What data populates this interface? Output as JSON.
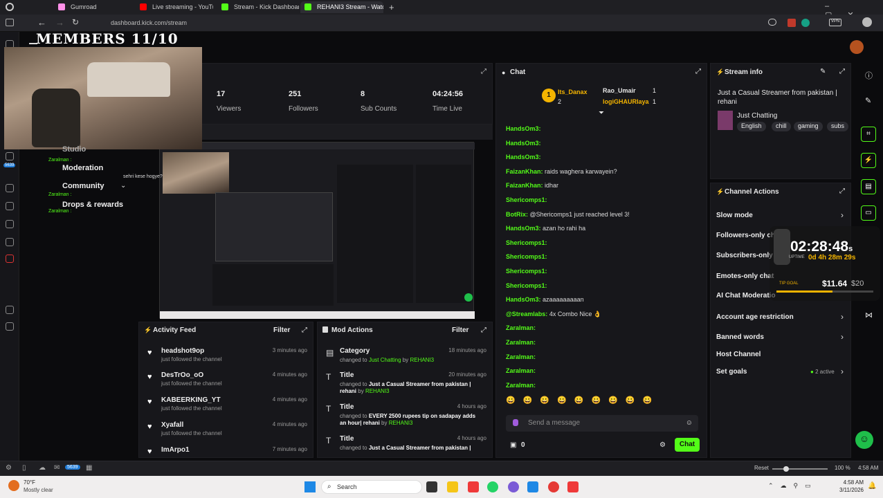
{
  "browser": {
    "tabs": [
      {
        "label": "Gumroad",
        "color": "#ff90e8",
        "active": false
      },
      {
        "label": "Live streaming - YouTube S",
        "color": "#ff0000",
        "active": false
      },
      {
        "label": "Stream - Kick Dashboard",
        "color": "#53fc18",
        "active": false
      },
      {
        "label": "REHANI3 Stream - Watch Li",
        "color": "#53fc18",
        "active": true
      }
    ],
    "new_tab": "+",
    "url": "dashboard.kick.com/stream"
  },
  "overlay": {
    "members": "MEMBERS 11/10"
  },
  "stats": {
    "viewers_value": "17",
    "viewers_label": "Viewers",
    "followers_value": "251",
    "followers_label": "Followers",
    "subs_value": "8",
    "subs_label": "Sub Counts",
    "time_value": "04:24:56",
    "time_label": "Time Live"
  },
  "nav": {
    "studio": "Studio",
    "moderation": "Moderation",
    "community": "Community",
    "drops": "Drops & rewards",
    "chat_snips": [
      "Zaralman :",
      "Zaralman :",
      "Zaralman :"
    ],
    "red_snip": "sehri kese hogye?"
  },
  "activity": {
    "title": "Activity Feed",
    "filter": "Filter",
    "items": [
      {
        "name": "headshot9op",
        "sub": "just followed the channel",
        "time": "3 minutes ago"
      },
      {
        "name": "DesTrOo_oO",
        "sub": "just followed the channel",
        "time": "4 minutes ago"
      },
      {
        "name": "KABEERKING_YT",
        "sub": "just followed the channel",
        "time": "4 minutes ago"
      },
      {
        "name": "Xyafall",
        "sub": "just followed the channel",
        "time": "4 minutes ago"
      },
      {
        "name": "ImArpo1",
        "sub": "",
        "time": "7 minutes ago"
      }
    ]
  },
  "mod": {
    "title": "Mod Actions",
    "filter": "Filter",
    "items": [
      {
        "title": "Category",
        "pre": "changed to",
        "val": "Just Chatting",
        "by": "by",
        "user": "REHANI3",
        "time": "18 minutes ago"
      },
      {
        "title": "Title",
        "pre": "changed to",
        "val": "Just a Casual Streamer from pakistan | rehani",
        "by": "by",
        "user": "REHANI3",
        "time": "20 minutes ago"
      },
      {
        "title": "Title",
        "pre": "changed to",
        "val": "EVERY 2500 rupees tip on sadapay adds an hour| rehani",
        "by": "by",
        "user": "REHANI3",
        "time": "4 hours ago"
      },
      {
        "title": "Title",
        "pre": "changed to",
        "val": "Just a Casual Streamer from pakistan |",
        "by": "",
        "user": "",
        "time": "4 hours ago"
      }
    ]
  },
  "chat": {
    "title": "Chat",
    "top_gifter1": "Its_Danax",
    "top_gifter1_count": "2",
    "top_gifter2": "Rao_Umair",
    "top_gifter2_count": "1",
    "top_gifter3": "logiGHAURIaya",
    "top_gifter3_count": "1",
    "lines": [
      {
        "user": "HandsOm3:",
        "msg": ""
      },
      {
        "user": "HandsOm3:",
        "msg": ""
      },
      {
        "user": "HandsOm3:",
        "msg": ""
      },
      {
        "user": "FaizanKhan:",
        "msg": "raids waghera karwayein?"
      },
      {
        "user": "FaizanKhan:",
        "msg": "idhar"
      },
      {
        "user": "Shericomps1:",
        "msg": ""
      },
      {
        "user": "BotRix:",
        "msg": "@Shericomps1 just reached level 3!"
      },
      {
        "user": "HandsOm3:",
        "msg": "azan ho rahi ha"
      },
      {
        "user": "Shericomps1:",
        "msg": ""
      },
      {
        "user": "Shericomps1:",
        "msg": ""
      },
      {
        "user": "Shericomps1:",
        "msg": ""
      },
      {
        "user": "Shericomps1:",
        "msg": ""
      },
      {
        "user": "HandsOm3:",
        "msg": "azaaaaaaaaan"
      },
      {
        "user": "@Streamlabs:",
        "msg": "4x Combo Nice 👌"
      },
      {
        "user": "Zaralman:",
        "msg": ""
      },
      {
        "user": "Zaralman:",
        "msg": ""
      },
      {
        "user": "Zaralman:",
        "msg": ""
      },
      {
        "user": "Zaralman:",
        "msg": ""
      },
      {
        "user": "Zaralman:",
        "msg": ""
      }
    ],
    "placeholder": "Send a message",
    "count": "0",
    "send": "Chat"
  },
  "info": {
    "title": "Stream info",
    "stream_title": "Just a Casual Streamer from pakistan | rehani",
    "category": "Just Chatting",
    "tags": [
      "English",
      "chill",
      "gaming",
      "subs"
    ]
  },
  "actions": {
    "title": "Channel Actions",
    "items": [
      "Slow mode",
      "Followers-only ch",
      "Subscribers-only",
      "Emotes-only chat",
      "AI Chat Moderatio",
      "Account age restriction",
      "Banned words",
      "Host Channel",
      "Set goals"
    ],
    "goals_active": "2 active"
  },
  "timer": {
    "clock": "02:28:48",
    "suffix": "s",
    "uptime_label": "UPTIME",
    "uptime": "0d 4h 28m 29s",
    "tip_label": "TIP GOAL",
    "tip_value": "$11.64",
    "tip_goal": "$20"
  },
  "statusbar": {
    "badge": "5639",
    "reset": "Reset",
    "zoom": "100 %",
    "time": "4:58 AM"
  },
  "taskbar": {
    "weather_temp": "70°F",
    "weather_desc": "Mostly clear",
    "search": "Search",
    "time": "4:58 AM",
    "date": "3/11/2026"
  }
}
